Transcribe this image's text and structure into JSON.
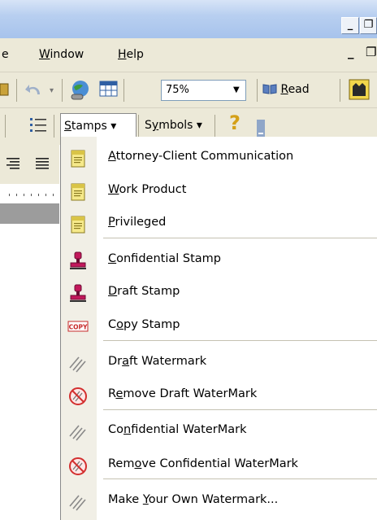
{
  "window": {
    "minimize_label": "_",
    "restore_label": "❐"
  },
  "menubar": {
    "partial_item": "e",
    "window_item": "Window",
    "window_mnemonic": "W",
    "window_rest": "indow",
    "help_mnemonic": "H",
    "help_rest": "elp",
    "doc_minimize": "_",
    "doc_restore": "❐"
  },
  "toolbar": {
    "zoom_value": "75%",
    "read_mnemonic": "R",
    "read_rest": "ead"
  },
  "toolbar2": {
    "stamps_mnemonic": "S",
    "stamps_rest": "tamps",
    "symbols_mnemonic": "y",
    "symbols_prefix": "S",
    "symbols_rest": "mbols",
    "dropdown_arrow": "▾",
    "help_glyph": "?"
  },
  "stamps_menu": {
    "items": [
      {
        "pre": "",
        "mn": "A",
        "post": "ttorney-Client Communication",
        "icon": "note-icon"
      },
      {
        "pre": "",
        "mn": "W",
        "post": "ork Product",
        "icon": "note-icon"
      },
      {
        "pre": "",
        "mn": "P",
        "post": "rivileged",
        "icon": "note-icon"
      },
      {
        "pre": "",
        "mn": "C",
        "post": "onfidential Stamp",
        "icon": "rubber-stamp-icon"
      },
      {
        "pre": "",
        "mn": "D",
        "post": "raft Stamp",
        "icon": "rubber-stamp-icon"
      },
      {
        "pre": "C",
        "mn": "o",
        "post": "py Stamp",
        "icon": "copy-stamp-icon"
      },
      {
        "pre": "Dr",
        "mn": "a",
        "post": "ft Watermark",
        "icon": "watermark-icon"
      },
      {
        "pre": "R",
        "mn": "e",
        "post": "move Draft WaterMark",
        "icon": "remove-watermark-icon"
      },
      {
        "pre": "Co",
        "mn": "n",
        "post": "fidential WaterMark",
        "icon": "watermark-icon"
      },
      {
        "pre": "Rem",
        "mn": "o",
        "post": "ve Confidential WaterMark",
        "icon": "remove-watermark-icon"
      },
      {
        "pre": "Make ",
        "mn": "Y",
        "post": "our Own Watermark...",
        "icon": "watermark-icon"
      }
    ],
    "copy_icon_text": "COPY"
  }
}
